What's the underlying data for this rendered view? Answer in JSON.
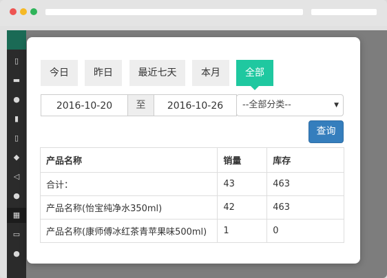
{
  "filters": {
    "tabs": [
      {
        "label": "今日"
      },
      {
        "label": "昨日"
      },
      {
        "label": "最近七天"
      },
      {
        "label": "本月"
      },
      {
        "label": "全部",
        "active": true
      }
    ],
    "start_date": "2016-10-20",
    "to_label": "至",
    "end_date": "2016-10-26",
    "category_selected": "--全部分类--",
    "query_label": "查询"
  },
  "table": {
    "headers": [
      "产品名称",
      "销量",
      "库存"
    ],
    "rows": [
      [
        "合计：",
        "43",
        "463"
      ],
      [
        "产品名称(怡宝纯净水350ml)",
        "42",
        "463"
      ],
      [
        "产品名称(康师傅冰红茶青苹果味500ml)",
        "1",
        "0"
      ]
    ]
  },
  "colors": {
    "accent": "#1fc8a0",
    "primary_button": "#357ebd"
  }
}
